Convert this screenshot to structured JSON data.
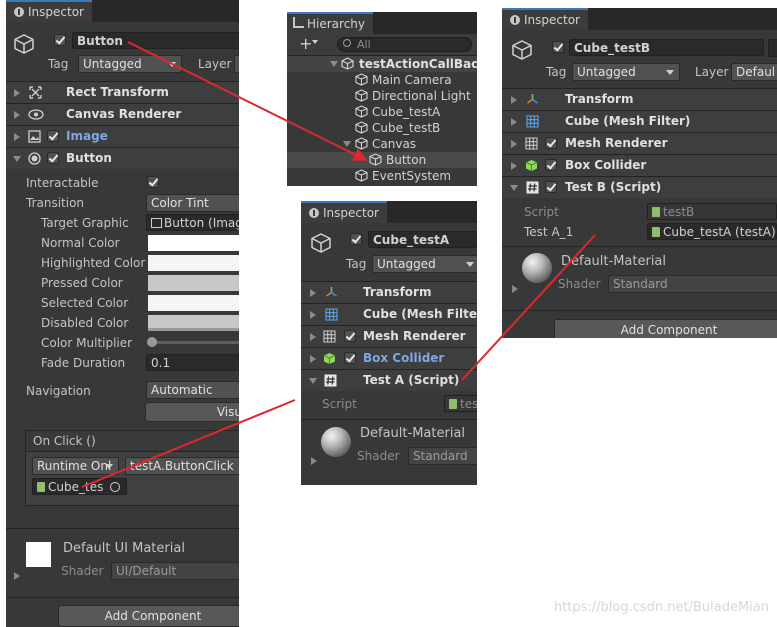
{
  "inspector_main": {
    "tab": "Inspector",
    "object_name": "Button",
    "tag_label": "Tag",
    "tag_value": "Untagged",
    "layer_label": "Layer",
    "components": [
      "Rect Transform",
      "Canvas Renderer",
      "Image",
      "Button"
    ],
    "button_fields": [
      {
        "label": "Interactable"
      },
      {
        "label": "Transition",
        "value": "Color Tint"
      },
      {
        "label": "Target Graphic",
        "value": "Button (Image"
      },
      {
        "label": "Normal Color"
      },
      {
        "label": "Highlighted Color"
      },
      {
        "label": "Pressed Color"
      },
      {
        "label": "Selected Color"
      },
      {
        "label": "Disabled Color"
      },
      {
        "label": "Color Multiplier"
      },
      {
        "label": "Fade Duration",
        "value": "0.1"
      }
    ],
    "navigation_label": "Navigation",
    "navigation_value": "Automatic",
    "visualize_label": "Visu",
    "onclick_header": "On Click ()",
    "runtime_value": "Runtime Onl",
    "function_value": "testA.ButtonClick",
    "object_ref": "Cube_tes",
    "material_name": "Default UI Material",
    "shader_label": "Shader",
    "shader_value": "UI/Default",
    "add_component": "Add Component"
  },
  "hierarchy": {
    "tab": "Hierarchy",
    "search_placeholder": "All",
    "scene": "testActionCallBack",
    "items": [
      "Main Camera",
      "Directional Light",
      "Cube_testA",
      "Cube_testB",
      "Canvas",
      "Button",
      "EventSystem"
    ]
  },
  "inspector_a": {
    "tab": "Inspector",
    "object_name": "Cube_testA",
    "tag_label": "Tag",
    "tag_value": "Untagged",
    "components": [
      "Transform",
      "Cube (Mesh Filter)",
      "Mesh Renderer",
      "Box Collider",
      "Test A (Script)"
    ],
    "script_label": "Script",
    "script_value": "tes",
    "material_name": "Default-Material",
    "shader_label": "Shader",
    "shader_value": "Standard"
  },
  "inspector_b": {
    "tab": "Inspector",
    "object_name": "Cube_testB",
    "tag_label": "Tag",
    "tag_value": "Untagged",
    "layer_label": "Layer",
    "layer_value": "Defaul",
    "components": [
      "Transform",
      "Cube (Mesh Filter)",
      "Mesh Renderer",
      "Box Collider",
      "Test B (Script)"
    ],
    "script_label": "Script",
    "script_value": "testB",
    "field_label": "Test A_1",
    "field_value": "Cube_testA (testA)",
    "material_name": "Default-Material",
    "shader_label": "Shader",
    "shader_value": "Standard",
    "add_component": "Add Component"
  },
  "watermark": "https://blog.csdn.net/BuladeMian",
  "colors": {
    "panel_bg": "#383838",
    "tab_bg": "#282828",
    "accent": "#3a79bb",
    "arrow": "#e0262f",
    "link_blue": "#7ea7e6"
  }
}
